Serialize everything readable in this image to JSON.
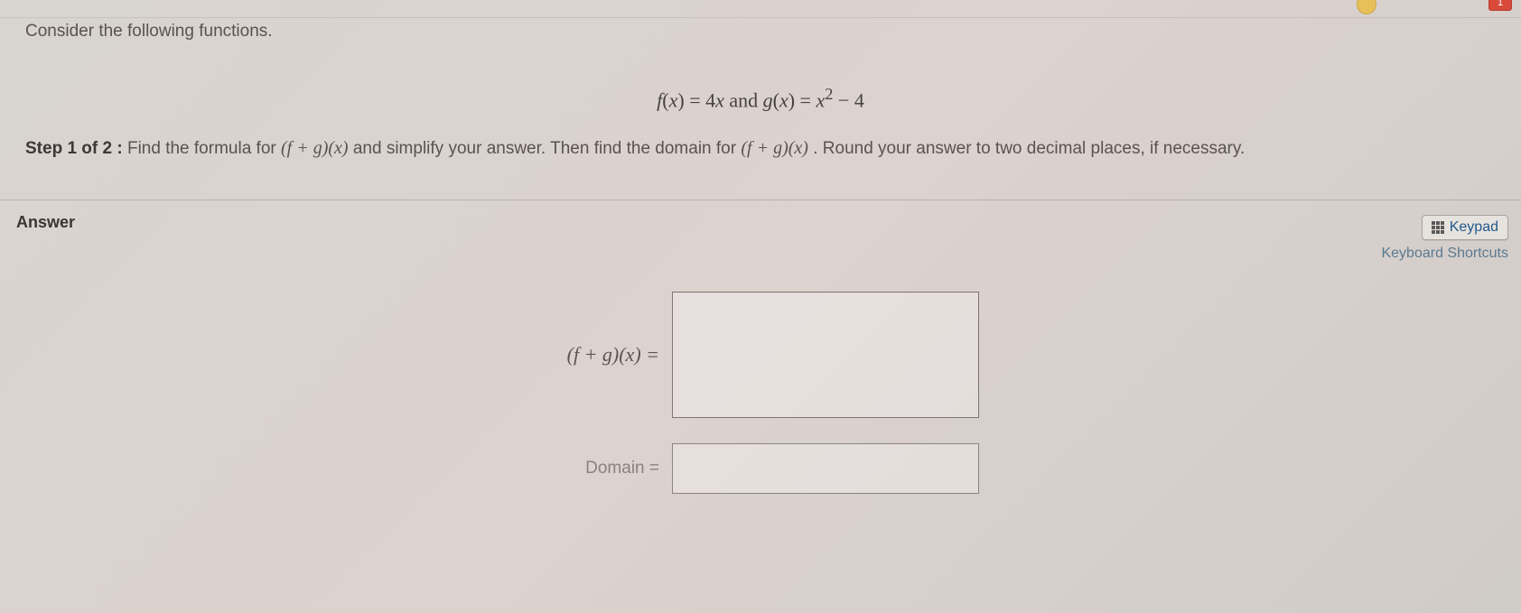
{
  "topbar": {
    "badge_count": "1"
  },
  "question": {
    "prompt": "Consider the following functions.",
    "functions_html": "f(x) = 4x and g(x) = x² − 4",
    "step_label": "Step 1 of 2 :",
    "step_text_before": "Find the formula for ",
    "step_math_1": "(f + g)(x)",
    "step_text_mid": " and simplify your answer. Then find the domain for ",
    "step_math_2": "(f + g)(x)",
    "step_text_after": ". Round your answer to two decimal places, if necessary."
  },
  "answer": {
    "heading": "Answer",
    "keypad_label": "Keypad",
    "kb_shortcuts_label": "Keyboard Shortcuts",
    "formula_label": "(f + g)(x) =",
    "formula_value": "",
    "domain_label": "Domain =",
    "domain_value": ""
  }
}
